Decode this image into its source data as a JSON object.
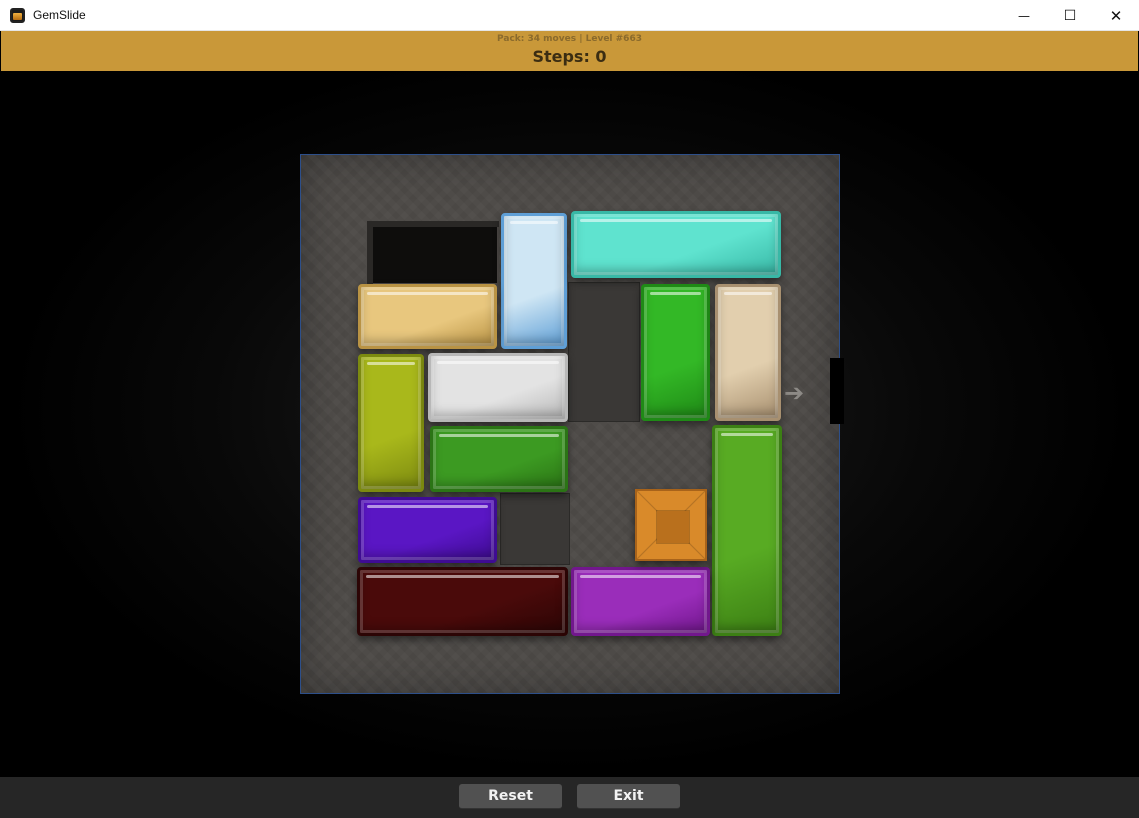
{
  "window": {
    "title": "GemSlide",
    "minimize_glyph": "—",
    "maximize_glyph": "☐",
    "close_glyph": "✕"
  },
  "header": {
    "pack_info": "Pack: 34 moves | Level #663",
    "steps": "Steps: 0"
  },
  "board": {
    "exit_glyph": "➔",
    "pieces": [
      {
        "name": "piece-ice-blue-vertical",
        "color": "#cfe6f4",
        "edge": "#5f9fd6"
      },
      {
        "name": "piece-aqua-horizontal",
        "color": "#5fe3cf",
        "edge": "#38b8a6"
      },
      {
        "name": "piece-sand-horizontal",
        "color": "#e8c77e",
        "edge": "#b99344"
      },
      {
        "name": "piece-green-vertical",
        "color": "#33b826",
        "edge": "#1f8a16"
      },
      {
        "name": "piece-beige-vertical",
        "color": "#e2cfae",
        "edge": "#a89070"
      },
      {
        "name": "piece-lime-vertical",
        "color": "#a9b81b",
        "edge": "#7c8a10"
      },
      {
        "name": "piece-white-horizontal",
        "color": "#e3e3e3",
        "edge": "#b8b8b8"
      },
      {
        "name": "piece-darkgreen-horizontal",
        "color": "#3c9a22",
        "edge": "#2b7415"
      },
      {
        "name": "piece-leafgreen-vertical",
        "color": "#58ab23",
        "edge": "#3c7f14"
      },
      {
        "name": "piece-indigo-horizontal",
        "color": "#5a16c4",
        "edge": "#3f0c93"
      },
      {
        "name": "piece-maroon-horizontal",
        "color": "#4a0a0a",
        "edge": "#2c0505"
      },
      {
        "name": "piece-magenta-horizontal",
        "color": "#9a2dba",
        "edge": "#72178d"
      },
      {
        "name": "target-gem-orange",
        "color": "#d98a2a",
        "edge": "#a8631a"
      }
    ]
  },
  "footer": {
    "reset_label": "Reset",
    "exit_label": "Exit"
  }
}
